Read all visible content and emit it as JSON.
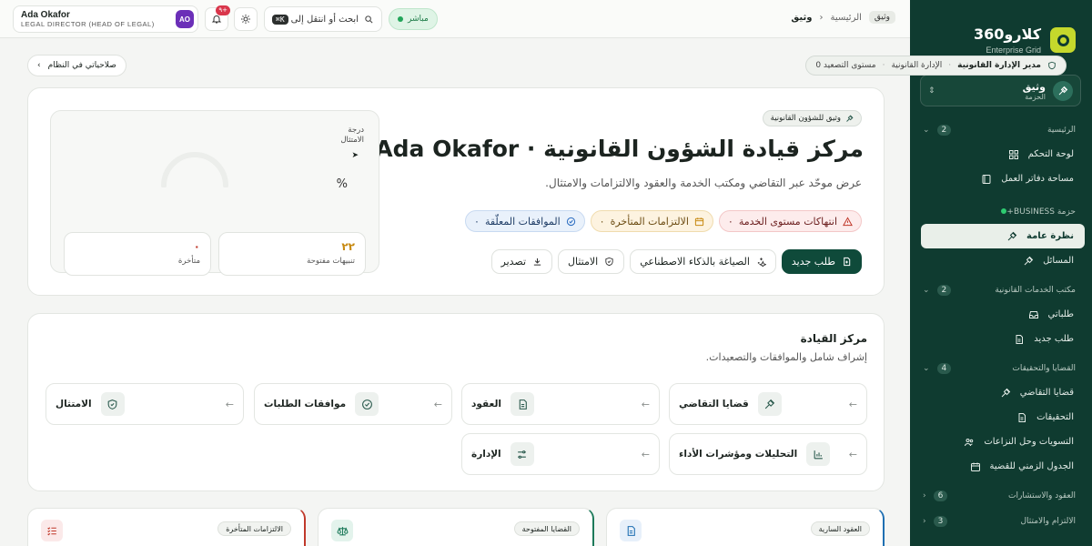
{
  "brand": {
    "name": "كلارو360",
    "subtitle": "Enterprise Grid"
  },
  "workspace": {
    "name": "وثيق",
    "subtitle": "الحزمة"
  },
  "sidebar": {
    "sections": [
      {
        "label": "الرئيسية",
        "count": "2"
      },
      {
        "label": "حزمة BUSINESS+"
      },
      {
        "label": "مكتب الخدمات القانونية",
        "count": "2"
      },
      {
        "label": "القضايا والتحقيقات",
        "count": "4"
      },
      {
        "label": "العقود والاستشارات",
        "count": "6"
      },
      {
        "label": "الالتزام والامتثال",
        "count": "3"
      }
    ],
    "items": [
      {
        "label": "لوحة التحكم",
        "icon": "grid-icon"
      },
      {
        "label": "مساحة دفاتر العمل",
        "icon": "notebook-icon"
      },
      {
        "label": "نظرة عامة",
        "icon": "gavel-icon"
      },
      {
        "label": "المسائل",
        "icon": "gavel-icon"
      },
      {
        "label": "طلباتي",
        "icon": "inbox-icon"
      },
      {
        "label": "طلب جديد",
        "icon": "document-icon"
      },
      {
        "label": "قضايا التقاضي",
        "icon": "gavel-icon"
      },
      {
        "label": "التحقيقات",
        "icon": "document-icon"
      },
      {
        "label": "التسويات وحل النزاعات",
        "icon": "people-icon"
      },
      {
        "label": "الجدول الزمني للقضية",
        "icon": "calendar-icon"
      }
    ]
  },
  "topbar": {
    "user_name": "Ada Okafor",
    "user_role": "LEGAL DIRECTOR (HEAD OF LEGAL)",
    "avatar_initials": "AO",
    "notif_count": "٩+",
    "search_placeholder": "ابحث أو انتقل إلى",
    "search_shortcut": "⌘K",
    "live_label": "مباشر",
    "crumb_tag": "وثيق",
    "crumb_home": "الرئيسية",
    "crumb_current": "وثيق"
  },
  "context": {
    "permissions_label": "صلاحياتي في النظام",
    "crumb_role": "مدير الإدارة القانونية",
    "crumb_dept": "الإدارة القانونية",
    "crumb_level": "مستوى التصعيد 0"
  },
  "hero": {
    "tag": "وثيق للشؤون القانونية",
    "title": "مركز قيادة الشؤون القانونية · Ada Okafor",
    "description": "عرض موحّد عبر التقاضي ومكتب الخدمة والعقود والالتزامات والامتثال.",
    "chips": [
      {
        "count": "٠",
        "label": "انتهاكات مستوى الخدمة"
      },
      {
        "count": "٠",
        "label": "الالتزامات المتأخرة"
      },
      {
        "count": "٠",
        "label": "الموافقات المعلّقة"
      }
    ],
    "actions": {
      "new_request": "طلب جديد",
      "ai_drafting": "الصياغة بالذكاء الاصطناعي",
      "compliance": "الامتثال",
      "export": "تصدير"
    },
    "score": {
      "label": "درجة الامتثال",
      "percent": "%",
      "open_alerts_value": "٢٢",
      "open_alerts_label": "تنبيهات مفتوحة",
      "overdue_value": "٠",
      "overdue_label": "متأخرة"
    }
  },
  "command_center": {
    "title": "مركز القيادة",
    "subtitle": "إشراف شامل والموافقات والتصعيدات.",
    "tiles": [
      {
        "label": "قضايا التقاضي",
        "icon": "gavel-icon"
      },
      {
        "label": "العقود",
        "icon": "document-icon"
      },
      {
        "label": "موافقات الطلبات",
        "icon": "check-circle-icon"
      },
      {
        "label": "الامتثال",
        "icon": "shield-icon"
      },
      {
        "label": "التحليلات ومؤشرات الأداء",
        "icon": "bar-chart-icon"
      },
      {
        "label": "الإدارة",
        "icon": "sliders-icon"
      }
    ]
  },
  "kpis": [
    {
      "label": "العقود السارية",
      "icon": "document-icon",
      "accent": "#1f6fb2"
    },
    {
      "label": "القضايا المفتوحة",
      "icon": "scales-icon",
      "accent": "#1d7a5a"
    },
    {
      "label": "الالتزامات المتأخرة",
      "icon": "list-check-icon",
      "accent": "#c0392b"
    }
  ],
  "colors": {
    "sidebar_bg": "#0f3b30",
    "primary": "#0f4a3a",
    "accent_lime": "#c5d82c"
  }
}
